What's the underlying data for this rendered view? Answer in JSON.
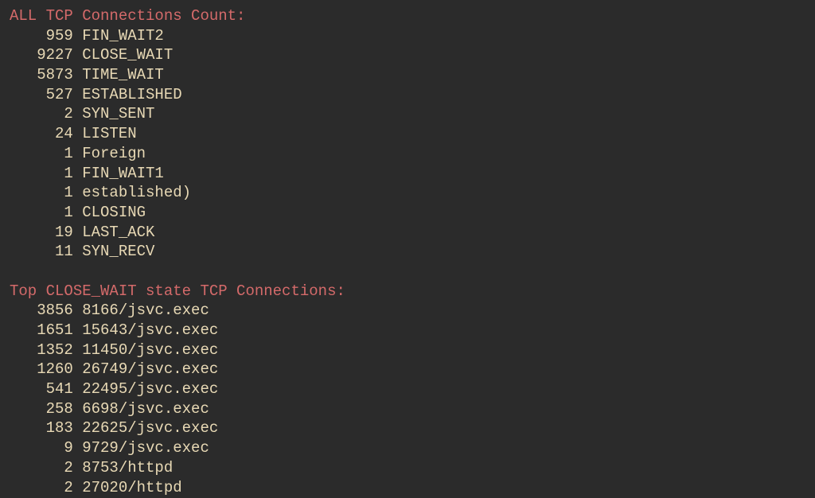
{
  "section1": {
    "title": "ALL TCP Connections Count:",
    "rows": [
      {
        "count": "959",
        "label": "FIN_WAIT2"
      },
      {
        "count": "9227",
        "label": "CLOSE_WAIT"
      },
      {
        "count": "5873",
        "label": "TIME_WAIT"
      },
      {
        "count": "527",
        "label": "ESTABLISHED"
      },
      {
        "count": "2",
        "label": "SYN_SENT"
      },
      {
        "count": "24",
        "label": "LISTEN"
      },
      {
        "count": "1",
        "label": "Foreign"
      },
      {
        "count": "1",
        "label": "FIN_WAIT1"
      },
      {
        "count": "1",
        "label": "established)"
      },
      {
        "count": "1",
        "label": "CLOSING"
      },
      {
        "count": "19",
        "label": "LAST_ACK"
      },
      {
        "count": "11",
        "label": "SYN_RECV"
      }
    ]
  },
  "section2": {
    "title": "Top CLOSE_WAIT state TCP Connections:",
    "rows": [
      {
        "count": "3856",
        "label": "8166/jsvc.exec"
      },
      {
        "count": "1651",
        "label": "15643/jsvc.exec"
      },
      {
        "count": "1352",
        "label": "11450/jsvc.exec"
      },
      {
        "count": "1260",
        "label": "26749/jsvc.exec"
      },
      {
        "count": "541",
        "label": "22495/jsvc.exec"
      },
      {
        "count": "258",
        "label": "6698/jsvc.exec"
      },
      {
        "count": "183",
        "label": "22625/jsvc.exec"
      },
      {
        "count": "9",
        "label": "9729/jsvc.exec"
      },
      {
        "count": "2",
        "label": "8753/httpd"
      },
      {
        "count": "2",
        "label": "27020/httpd"
      }
    ]
  }
}
